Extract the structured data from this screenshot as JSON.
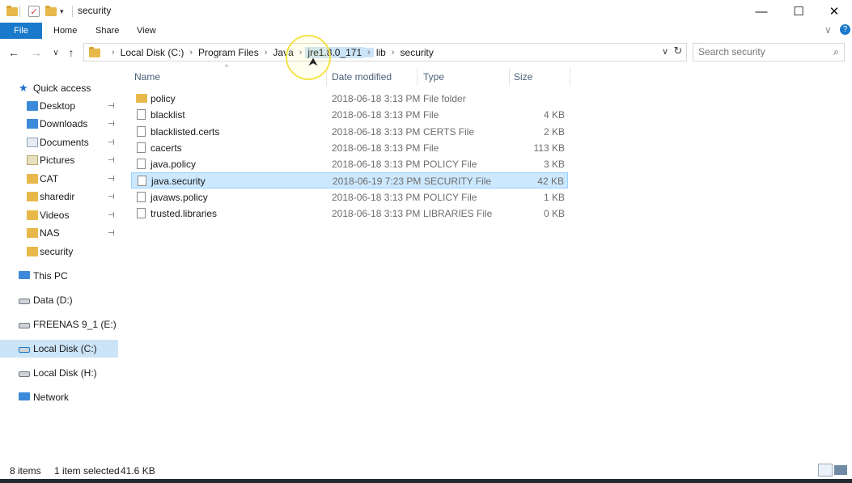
{
  "window": {
    "title": "security",
    "min_glyph": "—",
    "max_glyph": "☐",
    "close_glyph": "✕"
  },
  "ribbon": {
    "file": "File",
    "home": "Home",
    "share": "Share",
    "view": "View",
    "collapse": "∨",
    "help": "?"
  },
  "nav": {
    "back": "←",
    "forward": "→",
    "recent": "∨",
    "up": "↑"
  },
  "address": {
    "crumbs": [
      "Local Disk (C:)",
      "Program Files",
      "Java",
      "jre1.8.0_171",
      "lib",
      "security"
    ],
    "separator": "›",
    "dropdown": "∨",
    "refresh": "↻"
  },
  "search": {
    "placeholder": "Search security",
    "icon": "⌕"
  },
  "sidebar": {
    "quick_access": "Quick access",
    "items": [
      {
        "label": "Desktop",
        "pinned": true
      },
      {
        "label": "Downloads",
        "pinned": true
      },
      {
        "label": "Documents",
        "pinned": true
      },
      {
        "label": "Pictures",
        "pinned": true
      },
      {
        "label": "CAT",
        "pinned": true
      },
      {
        "label": "sharedir",
        "pinned": true
      },
      {
        "label": "Videos",
        "pinned": true
      },
      {
        "label": "NAS",
        "pinned": true
      },
      {
        "label": "security",
        "pinned": false
      }
    ],
    "this_pc": "This PC",
    "drives": [
      {
        "label": "Data (D:)"
      },
      {
        "label": "FREENAS 9_1 (E:)"
      },
      {
        "label": "Local Disk (C:)"
      },
      {
        "label": "Local Disk (H:)"
      }
    ],
    "network": "Network",
    "pin_glyph": "📌"
  },
  "columns": {
    "name": "Name",
    "date": "Date modified",
    "type": "Type",
    "size": "Size",
    "sort": "^"
  },
  "files": [
    {
      "name": "policy",
      "date": "2018-06-18 3:13 PM",
      "type": "File folder",
      "size": ""
    },
    {
      "name": "blacklist",
      "date": "2018-06-18 3:13 PM",
      "type": "File",
      "size": "4 KB"
    },
    {
      "name": "blacklisted.certs",
      "date": "2018-06-18 3:13 PM",
      "type": "CERTS File",
      "size": "2 KB"
    },
    {
      "name": "cacerts",
      "date": "2018-06-18 3:13 PM",
      "type": "File",
      "size": "113 KB"
    },
    {
      "name": "java.policy",
      "date": "2018-06-18 3:13 PM",
      "type": "POLICY File",
      "size": "3 KB"
    },
    {
      "name": "java.security",
      "date": "2018-06-19 7:23 PM",
      "type": "SECURITY File",
      "size": "42 KB"
    },
    {
      "name": "javaws.policy",
      "date": "2018-06-18 3:13 PM",
      "type": "POLICY File",
      "size": "1 KB"
    },
    {
      "name": "trusted.libraries",
      "date": "2018-06-18 3:13 PM",
      "type": "LIBRARIES File",
      "size": "0 KB"
    }
  ],
  "status": {
    "count": "8 items",
    "selected": "1 item selected",
    "size": "41.6 KB"
  },
  "colors": {
    "accent": "#1979ca",
    "selection": "#cce8ff",
    "highlight": "#cce4f7"
  }
}
